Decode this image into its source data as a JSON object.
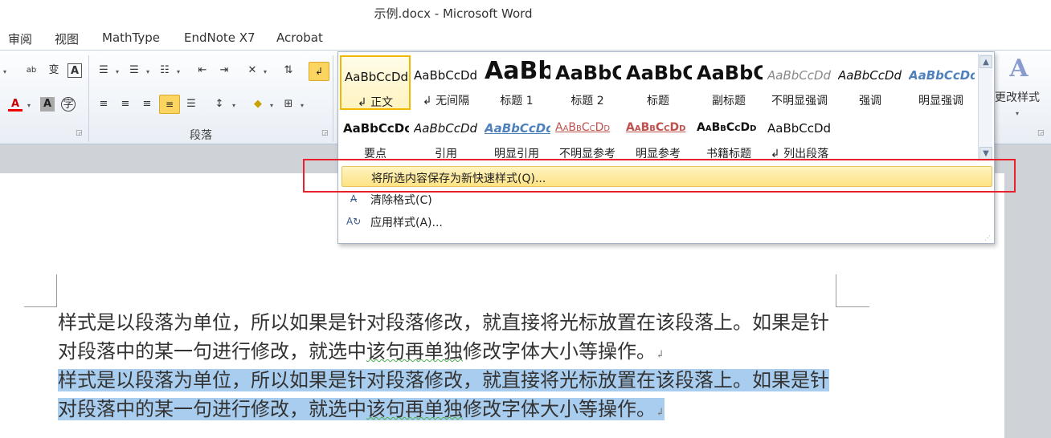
{
  "window": {
    "title": "示例.docx - Microsoft Word"
  },
  "tabs": [
    "审阅",
    "视图",
    "MathType",
    "EndNote X7",
    "Acrobat"
  ],
  "ribbon": {
    "paragraph_group_label": "段落",
    "change_styles_label": "更改样式",
    "change_styles_glyph": "A"
  },
  "style_gallery": {
    "items": [
      {
        "preview": "AaBbCcDd",
        "name": "↲ 正文",
        "selected": true
      },
      {
        "preview": "AaBbCcDd",
        "name": "↲ 无间隔"
      },
      {
        "preview": "AaBb",
        "name": "标题 1"
      },
      {
        "preview": "AaBbC",
        "name": "标题 2"
      },
      {
        "preview": "AaBbC",
        "name": "标题"
      },
      {
        "preview": "AaBbC",
        "name": "副标题"
      },
      {
        "preview": "AaBbCcDd",
        "name": "不明显强调"
      },
      {
        "preview": "AaBbCcDd",
        "name": "强调"
      },
      {
        "preview": "AaBbCcDd",
        "name": "明显强调"
      },
      {
        "preview": "AaBbCcDc",
        "name": "要点"
      },
      {
        "preview": "AaBbCcDd",
        "name": "引用"
      },
      {
        "preview": "AaBbCcDd",
        "name": "明显引用"
      },
      {
        "preview": "AaBbCcDd",
        "name": "不明显参考"
      },
      {
        "preview": "AaBbCcDd",
        "name": "明显参考"
      },
      {
        "preview": "AaBbCcDd",
        "name": "书籍标题"
      },
      {
        "preview": "AaBbCcDd",
        "name": "↲ 列出段落"
      }
    ],
    "menu": {
      "save_as_quick_style": "将所选内容保存为新快速样式(Q)...",
      "clear_formatting": "清除格式(C)",
      "apply_styles": "应用样式(A)..."
    }
  },
  "document": {
    "paragraphs": [
      {
        "line1": "样式是以段落为单位，所以如果是针对段落修改，就直接将光标放置在该段落上。如果是针",
        "line2_a": "对段落中的某一句进行修改，就选中",
        "line2_b": "该句再单独",
        "line2_c": "修改字体大小等操作。",
        "mark": "↲",
        "selected": false
      },
      {
        "line1": "样式是以段落为单位，所以如果是针对段落修改，就直接将光标放置在该段落上。如果是针",
        "line2_a": "对段落中的某一句进行修改，就选中",
        "line2_b": "该句再单独",
        "line2_c": "修改字体大小等操作。",
        "mark": "↲",
        "selected": true
      }
    ]
  },
  "colors": {
    "selection_highlight": "#a9cdee",
    "highlight_menu_item": "#fde383",
    "annotation_box": "#e8212a",
    "selected_style_border": "#f0b800"
  }
}
